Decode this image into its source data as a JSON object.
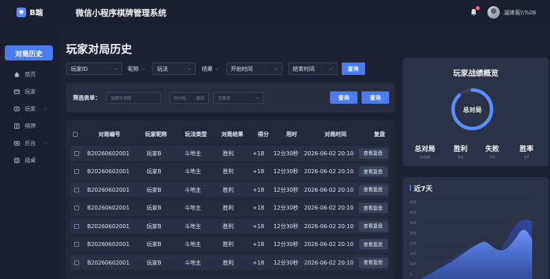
{
  "app": {
    "logo_text": "B端",
    "system_title": "微信小程序棋牌管理系统",
    "notification_count": "1",
    "user_name": "凝建莪\\\\%06"
  },
  "sidebar": {
    "active_label": "对局历史",
    "items": [
      {
        "label": "首页",
        "icon": "home-icon",
        "has_children": false
      },
      {
        "label": "玩家",
        "icon": "player-icon",
        "has_children": false
      },
      {
        "label": "玩家",
        "icon": "player-group-icon",
        "has_children": true
      },
      {
        "label": "棋牌",
        "icon": "board-icon",
        "has_children": false
      },
      {
        "label": "后台",
        "icon": "backend-icon",
        "has_children": true
      },
      {
        "label": "插桌",
        "icon": "table-icon",
        "has_children": false
      }
    ]
  },
  "page": {
    "title": "玩家对局历史"
  },
  "filters": {
    "player_id": "玩家ID",
    "nickname_label": "昵称",
    "play_type": "玩法",
    "result_label": "结果",
    "start_time": "开始时间",
    "end_time": "结束时间",
    "query_button": "查询"
  },
  "filter_panel": {
    "label": "筛选表单：",
    "input1_placeholder": "诚输符调碲",
    "input2_placeholder": "时间秘",
    "input3_placeholder": "撒释",
    "select_placeholder": "苍栗单",
    "query_button_1": "查询",
    "query_button_2": "查询"
  },
  "table": {
    "headers": [
      "对局编号",
      "玩家昵称",
      "玩法类型",
      "对局结果",
      "得分",
      "用时",
      "对局时间",
      "复盘"
    ],
    "rows": [
      {
        "id": "B20260602001",
        "nickname": "玩家B",
        "play_type": "斗地主",
        "result": "胜利",
        "score": "+18",
        "duration": "12分30秒",
        "time": "2026-06-02 20:10",
        "action": "查看复盘"
      },
      {
        "id": "B20260602001",
        "nickname": "玩家B",
        "play_type": "斗地主",
        "result": "胜利",
        "score": "+18",
        "duration": "12分30秒",
        "time": "2026-06-02 20:10",
        "action": "查看复盘"
      },
      {
        "id": "B20260602001",
        "nickname": "玩家B",
        "play_type": "斗地主",
        "result": "胜利",
        "score": "+18",
        "duration": "12分30秒",
        "time": "2026-06-02 20:10",
        "action": "查看复盘"
      },
      {
        "id": "B20260602001",
        "nickname": "玩家B",
        "play_type": "斗地主",
        "result": "胜利",
        "score": "+18",
        "duration": "12分30秒",
        "time": "2026-06-02 20:10",
        "action": "查看复盘"
      },
      {
        "id": "B20260602001",
        "nickname": "玩家B",
        "play_type": "斗地主",
        "result": "胜利",
        "score": "+18",
        "duration": "12分30秒",
        "time": "2026-06-02 20:10",
        "action": "查看复盘"
      },
      {
        "id": "B20260602001",
        "nickname": "玩家B",
        "play_type": "斗地主",
        "result": "胜利",
        "score": "+18",
        "duration": "12分30秒",
        "time": "2026-06-02 20:10",
        "action": "查看复盘"
      },
      {
        "id": "B20260602001",
        "nickname": "玩家B",
        "play_type": "斗地主",
        "result": "胜利",
        "score": "+18",
        "duration": "12分30秒",
        "time": "2026-06-02 20:10",
        "action": "查看复盘"
      }
    ]
  },
  "stats": {
    "title": "玩家战绩概览",
    "ring_label": "总对局",
    "ring_fraction": 0.88,
    "items": [
      {
        "label": "总对局",
        "sub": "总对局数"
      },
      {
        "label": "胜利",
        "sub": "胜场"
      },
      {
        "label": "失败",
        "sub": "负场"
      },
      {
        "label": "胜率",
        "sub": "胜率"
      }
    ]
  },
  "trend": {
    "title": "近7天",
    "y_ticks": [
      "800",
      "600",
      "400",
      "200",
      "150",
      "100",
      "500",
      "0"
    ]
  },
  "colors": {
    "accent": "#4b7cf0",
    "background": "#1d2232",
    "card": "#2b3246"
  }
}
